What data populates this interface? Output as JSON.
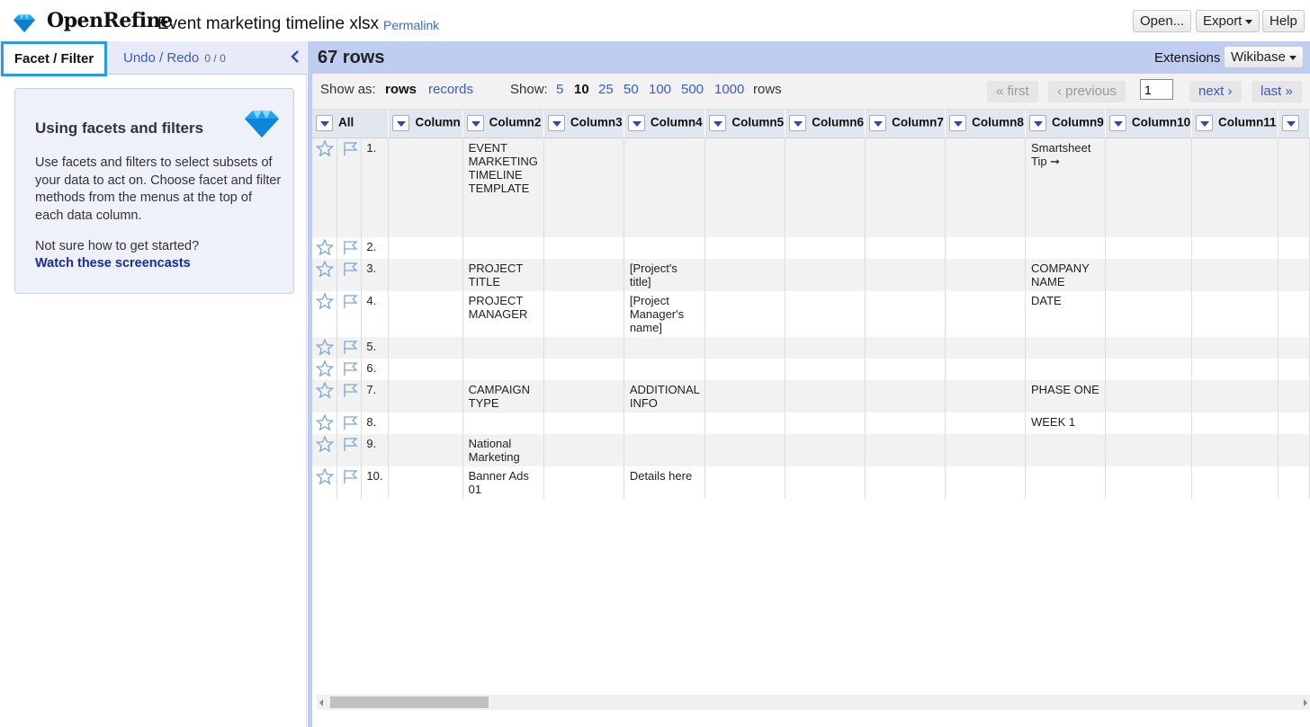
{
  "header": {
    "logo_text": "OpenRefine",
    "project_title": "Event marketing timeline xlsx",
    "permalink": "Permalink",
    "open_label": "Open...",
    "export_label": "Export",
    "help_label": "Help"
  },
  "left_panel": {
    "tab_facet": "Facet / Filter",
    "tab_undo": "Undo / Redo",
    "undo_count": "0 / 0",
    "help_title": "Using facets and filters",
    "help_body": "Use facets and filters to select subsets of your data to act on. Choose facet and filter methods from the menus at the top of each data column.",
    "help_question": "Not sure how to get started?",
    "help_link": "Watch these screencasts"
  },
  "summary": {
    "row_count": "67 rows",
    "extensions_label": "Extensions",
    "wikibase_label": "Wikibase"
  },
  "view_bar": {
    "show_as_label": "Show as:",
    "rows_option": "rows",
    "records_option": "records",
    "show_label": "Show:",
    "page_sizes": [
      "5",
      "10",
      "25",
      "50",
      "100",
      "500",
      "1000"
    ],
    "selected_page_size": "10",
    "rows_suffix": "rows",
    "first": "« first",
    "previous": "‹ previous",
    "page_number": "1",
    "next": "next ›",
    "last": "last »"
  },
  "grid": {
    "all_label": "All",
    "columns": [
      "Column",
      "Column2",
      "Column3",
      "Column4",
      "Column5",
      "Column6",
      "Column7",
      "Column8",
      "Column9",
      "Column10",
      "Column11"
    ],
    "rows": [
      {
        "index": "1.",
        "cells": [
          "",
          "EVENT MARKETING TIMELINE TEMPLATE",
          "",
          "",
          "",
          "",
          "",
          "",
          "Smartsheet Tip ➞",
          "",
          ""
        ]
      },
      {
        "index": "2.",
        "cells": [
          "",
          "",
          "",
          "",
          "",
          "",
          "",
          "",
          "",
          "",
          ""
        ]
      },
      {
        "index": "3.",
        "cells": [
          "",
          "PROJECT TITLE",
          "",
          "[Project's title]",
          "",
          "",
          "",
          "",
          "COMPANY NAME",
          "",
          ""
        ]
      },
      {
        "index": "4.",
        "cells": [
          "",
          "PROJECT MANAGER",
          "",
          "[Project Manager's name]",
          "",
          "",
          "",
          "",
          "DATE",
          "",
          ""
        ]
      },
      {
        "index": "5.",
        "cells": [
          "",
          "",
          "",
          "",
          "",
          "",
          "",
          "",
          "",
          "",
          ""
        ]
      },
      {
        "index": "6.",
        "cells": [
          "",
          "",
          "",
          "",
          "",
          "",
          "",
          "",
          "",
          "",
          ""
        ]
      },
      {
        "index": "7.",
        "cells": [
          "",
          "CAMPAIGN TYPE",
          "",
          "ADDITIONAL INFO",
          "",
          "",
          "",
          "",
          "PHASE ONE",
          "",
          ""
        ]
      },
      {
        "index": "8.",
        "cells": [
          "",
          "",
          "",
          "",
          "",
          "",
          "",
          "",
          "WEEK 1",
          "",
          ""
        ]
      },
      {
        "index": "9.",
        "cells": [
          "",
          "National Marketing",
          "",
          "",
          "",
          "",
          "",
          "",
          "",
          "",
          ""
        ]
      },
      {
        "index": "10.",
        "cells": [
          "",
          "Banner Ads 01",
          "",
          "Details here",
          "",
          "",
          "",
          "",
          "",
          "",
          ""
        ]
      }
    ]
  },
  "colors": {
    "accent": "#2a9de0",
    "panel_blue": "#bfcdf2",
    "link": "#3a5bc4"
  }
}
